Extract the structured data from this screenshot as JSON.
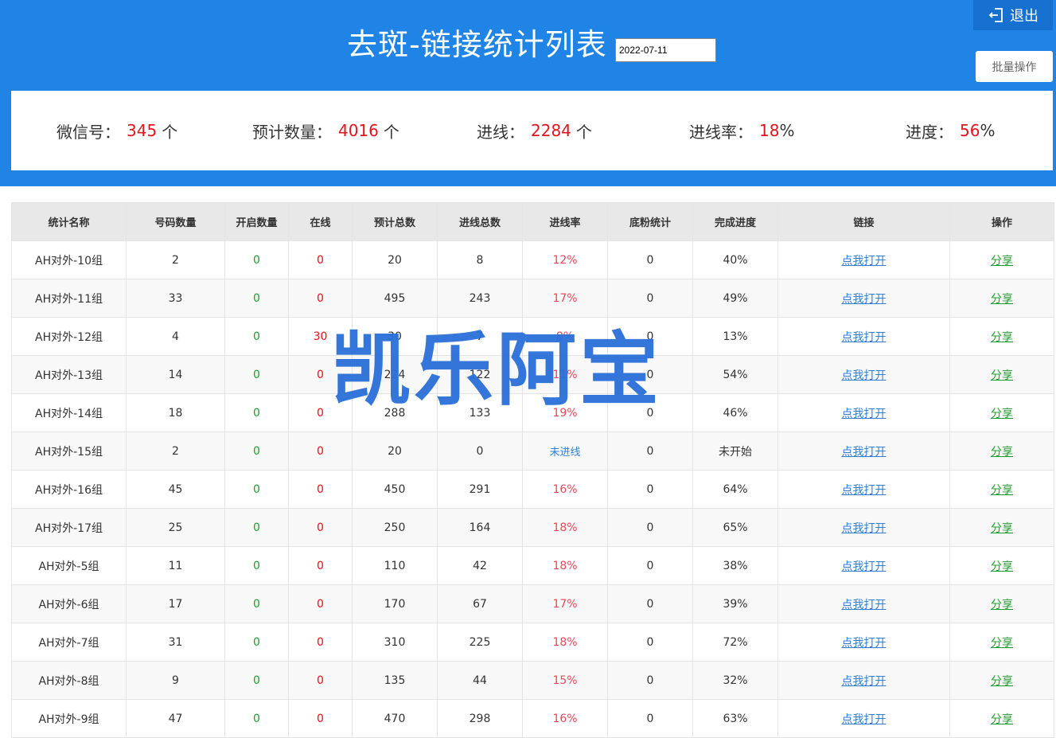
{
  "header": {
    "title": "去斑-链接统计列表",
    "date_value": "2022-07-11",
    "logout_label": "退出",
    "batch_label": "批量操作"
  },
  "stats": {
    "wechat": {
      "label": "微信号：",
      "value": "345",
      "unit": "个"
    },
    "expected": {
      "label": "预计数量：",
      "value": "4016",
      "unit": "个"
    },
    "joined": {
      "label": "进线：",
      "value": "2284",
      "unit": "个"
    },
    "rate": {
      "label": "进线率：",
      "value": "18",
      "unit": "%"
    },
    "progress": {
      "label": "进度：",
      "value": "56",
      "unit": "%"
    }
  },
  "table": {
    "headers": [
      "统计名称",
      "号码数量",
      "开启数量",
      "在线",
      "预计总数",
      "进线总数",
      "进线率",
      "底粉统计",
      "完成进度",
      "链接",
      "操作"
    ],
    "rows": [
      {
        "name": "AH对外-10组",
        "count": "2",
        "enabled": "0",
        "online": "0",
        "expected": "20",
        "joined": "8",
        "rate": "12%",
        "base": "0",
        "progress": "40%",
        "link": "点我打开",
        "action": "分享"
      },
      {
        "name": "AH对外-11组",
        "count": "33",
        "enabled": "0",
        "online": "0",
        "expected": "495",
        "joined": "243",
        "rate": "17%",
        "base": "0",
        "progress": "49%",
        "link": "点我打开",
        "action": "分享"
      },
      {
        "name": "AH对外-12组",
        "count": "4",
        "enabled": "0",
        "online": "30",
        "expected": "30",
        "joined": "7",
        "rate": "8%",
        "base": "0",
        "progress": "13%",
        "link": "点我打开",
        "action": "分享"
      },
      {
        "name": "AH对外-13组",
        "count": "14",
        "enabled": "0",
        "online": "0",
        "expected": "224",
        "joined": "122",
        "rate": "11%",
        "base": "0",
        "progress": "54%",
        "link": "点我打开",
        "action": "分享"
      },
      {
        "name": "AH对外-14组",
        "count": "18",
        "enabled": "0",
        "online": "0",
        "expected": "288",
        "joined": "133",
        "rate": "19%",
        "base": "0",
        "progress": "46%",
        "link": "点我打开",
        "action": "分享"
      },
      {
        "name": "AH对外-15组",
        "count": "2",
        "enabled": "0",
        "online": "0",
        "expected": "20",
        "joined": "0",
        "rate": "未进线",
        "base": "0",
        "progress": "未开始",
        "link": "点我打开",
        "action": "分享"
      },
      {
        "name": "AH对外-16组",
        "count": "45",
        "enabled": "0",
        "online": "0",
        "expected": "450",
        "joined": "291",
        "rate": "16%",
        "base": "0",
        "progress": "64%",
        "link": "点我打开",
        "action": "分享"
      },
      {
        "name": "AH对外-17组",
        "count": "25",
        "enabled": "0",
        "online": "0",
        "expected": "250",
        "joined": "164",
        "rate": "18%",
        "base": "0",
        "progress": "65%",
        "link": "点我打开",
        "action": "分享"
      },
      {
        "name": "AH对外-5组",
        "count": "11",
        "enabled": "0",
        "online": "0",
        "expected": "110",
        "joined": "42",
        "rate": "18%",
        "base": "0",
        "progress": "38%",
        "link": "点我打开",
        "action": "分享"
      },
      {
        "name": "AH对外-6组",
        "count": "17",
        "enabled": "0",
        "online": "0",
        "expected": "170",
        "joined": "67",
        "rate": "17%",
        "base": "0",
        "progress": "39%",
        "link": "点我打开",
        "action": "分享"
      },
      {
        "name": "AH对外-7组",
        "count": "31",
        "enabled": "0",
        "online": "0",
        "expected": "310",
        "joined": "225",
        "rate": "18%",
        "base": "0",
        "progress": "72%",
        "link": "点我打开",
        "action": "分享"
      },
      {
        "name": "AH对外-8组",
        "count": "9",
        "enabled": "0",
        "online": "0",
        "expected": "135",
        "joined": "44",
        "rate": "15%",
        "base": "0",
        "progress": "32%",
        "link": "点我打开",
        "action": "分享"
      },
      {
        "name": "AH对外-9组",
        "count": "47",
        "enabled": "0",
        "online": "0",
        "expected": "470",
        "joined": "298",
        "rate": "16%",
        "base": "0",
        "progress": "63%",
        "link": "点我打开",
        "action": "分享"
      }
    ]
  },
  "watermark": "凯乐阿宝",
  "icons": {
    "logout": "logout-icon"
  },
  "colors": {
    "header_bg": "#1f84e6",
    "highlight": "#e0141e",
    "link": "#2f7fd8",
    "green": "#1e9e2e"
  }
}
